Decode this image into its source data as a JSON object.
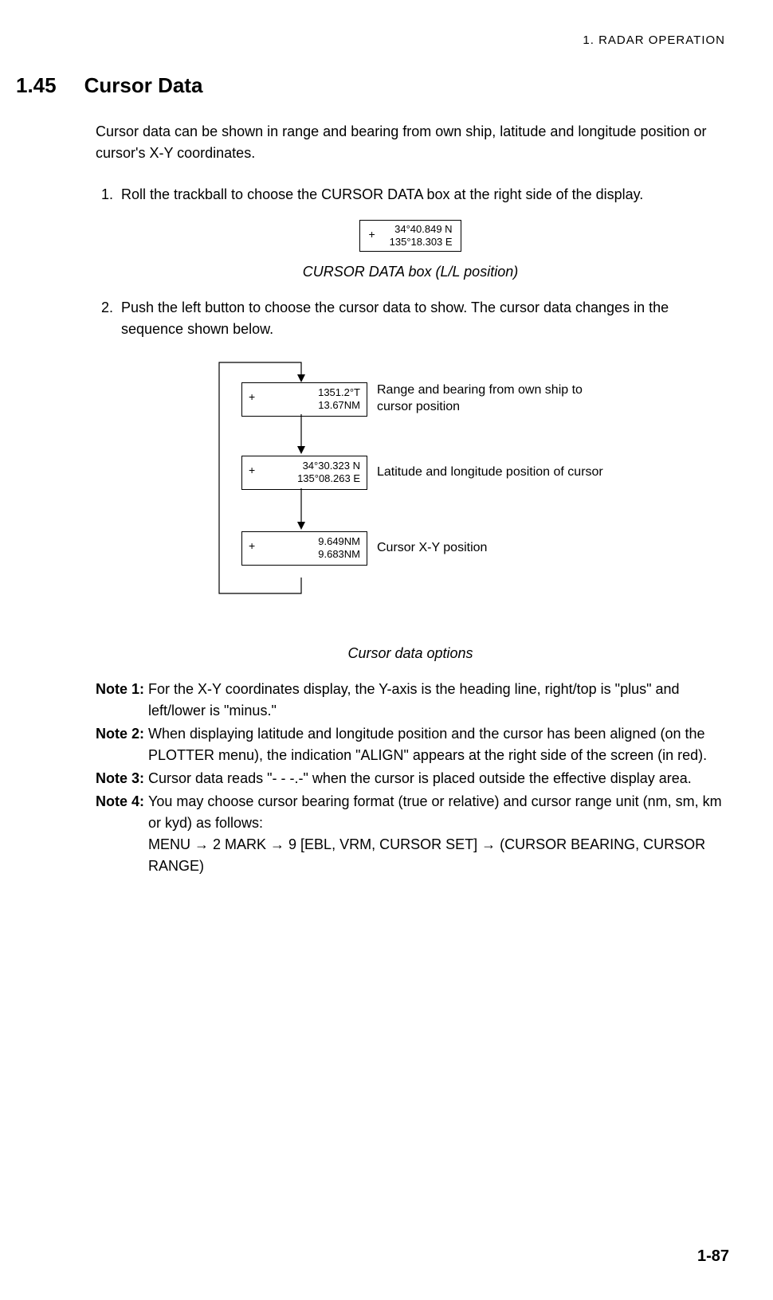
{
  "header": {
    "chapter": "1.  RADAR  OPERATION"
  },
  "section": {
    "number": "1.45",
    "title": "Cursor Data"
  },
  "intro": "Cursor data can be shown in range and bearing from own ship, latitude and longitude position or cursor's X-Y coordinates.",
  "steps": {
    "s1_num": "1.",
    "s1_text": "Roll the trackball to choose the CURSOR DATA box at the right side of the display.",
    "s2_num": "2.",
    "s2_text": "Push the left button to choose the cursor data to show. The cursor data changes in the sequence shown below."
  },
  "cursor_box_top": {
    "plus": "+",
    "line1": "34°40.849 N",
    "line2": "135°18.303 E"
  },
  "fig1_caption": "CURSOR DATA box (L/L position)",
  "diagram": {
    "box1": {
      "plus": "+",
      "line1": "1351.2°T",
      "line2": "13.67NM",
      "desc": "Range and bearing from own ship to cursor position"
    },
    "box2": {
      "plus": "+",
      "line1": "34°30.323 N",
      "line2": "135°08.263 E",
      "desc": "Latitude and longitude position of cursor"
    },
    "box3": {
      "plus": "+",
      "line1": "9.649NM",
      "line2": "9.683NM",
      "desc": "Cursor X-Y position"
    }
  },
  "fig2_caption": "Cursor data options",
  "notes": {
    "n1_label": "Note 1:",
    "n1_text": "For the X-Y coordinates display, the Y-axis is the heading line, right/top is \"plus\" and left/lower is \"minus.\"",
    "n2_label": "Note 2:",
    "n2_text": "When displaying latitude and longitude position and the cursor has been aligned (on the PLOTTER menu), the indication \"ALIGN\" appears at the right side of the screen (in red).",
    "n3_label": "Note 3:",
    "n3_text": "Cursor data reads \"- - -.-\" when the cursor is placed outside the effective display area.",
    "n4_label": "Note 4:",
    "n4_text_a": "You may choose cursor bearing format (true or relative) and cursor range unit (nm, sm, km or kyd) as follows:",
    "n4_text_b": "MENU → 2 MARK → 9 [EBL, VRM, CURSOR SET] → (CURSOR BEARING, CURSOR RANGE)"
  },
  "page_number": "1-87"
}
